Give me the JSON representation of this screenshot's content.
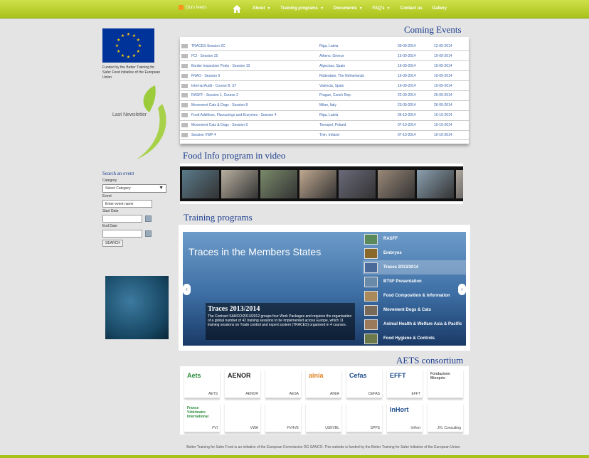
{
  "topbar": {
    "feeds_label": "Ours feeds",
    "nav": [
      {
        "label": "About",
        "caret": true
      },
      {
        "label": "Training programs",
        "caret": true
      },
      {
        "label": "Documents",
        "caret": true
      },
      {
        "label": "FAQ's",
        "caret": true
      },
      {
        "label": "Contact us",
        "caret": false
      },
      {
        "label": "Gallery",
        "caret": false
      }
    ]
  },
  "sidebar": {
    "funded_text": "Funded by the Better Training for Safer Food initiative of the European Union",
    "newsletter_label": "Last Newsletter",
    "search": {
      "heading": "Search an event",
      "category_label": "Category",
      "category_value": "Select Category",
      "event_label": "Event",
      "event_placeholder": "Enter event name",
      "start_label": "Start Date",
      "end_label": "End Date",
      "button": "SEARCH"
    }
  },
  "coming_events": {
    "title": "Coming Events",
    "rows": [
      {
        "name": "TRACES-Session 3C",
        "place": "Riga, Latvia",
        "start": "09-09-2014",
        "end": "12-09-2014"
      },
      {
        "name": "FCI - Session 15",
        "place": "Athens, Greece",
        "start": "15-09-2014",
        "end": "19-09-2014"
      },
      {
        "name": "Border Inspection Posts - Session 10",
        "place": "Algeciras, Spain",
        "start": "16-09-2014",
        "end": "19-09-2014"
      },
      {
        "name": "FNAO - Session 9",
        "place": "Rotterdam, The Netherlands",
        "start": "16-09-2014",
        "end": "19-09-2014"
      },
      {
        "name": "Internal Audit - Course B, S7",
        "place": "Valencia, Spain",
        "start": "16-09-2014",
        "end": "19-09-2014"
      },
      {
        "name": "RASFF - Session 1, Course 2",
        "place": "Prague, Czech Rep.",
        "start": "22-09-2014",
        "end": "26-09-2014"
      },
      {
        "name": "Movement Cats & Dogs - Session 8",
        "place": "Milan, Italy",
        "start": "23-09-2014",
        "end": "26-09-2014"
      },
      {
        "name": "Food Additives, Flavourings and Enzymes - Session 4",
        "place": "Riga, Latvia",
        "start": "06-10-2014",
        "end": "10-10-2014"
      },
      {
        "name": "Movement Cats & Dogs - Session 9",
        "place": "Terespol, Poland",
        "start": "07-10-2014",
        "end": "10-10-2014"
      },
      {
        "name": "Session VWP 4",
        "place": "Trim, Ireland",
        "start": "07-10-2014",
        "end": "10-10-2014"
      }
    ]
  },
  "video": {
    "title": "Food Info program in video"
  },
  "training": {
    "title": "Training programs",
    "slide_title": "Traces in the Members States",
    "caption_heading": "Traces 2013/2014",
    "caption_text": "The Contract SANCO/2013/2012 groups four Work Packages and requires the organisation of a global number of 42 training sessions to be implemented across Europe, which 11 training sessions on Trade control and expert system (TRACES) organised in 4 courses.",
    "programs": [
      "RASFF",
      "Embryos",
      "Traces 2013/2014",
      "BTSF Presentation",
      "Food Composition & Information",
      "Movement Dogs & Cats",
      "Animal Health & Welfare Asia & Pacific",
      "Food Hygiene & Controls"
    ],
    "active_index": 2
  },
  "consortium": {
    "title": "AETS consortium",
    "logos": [
      {
        "mark": "Aets",
        "name": "AETS"
      },
      {
        "mark": "AENOR",
        "name": "AENOR"
      },
      {
        "mark": "",
        "name": "AESA"
      },
      {
        "mark": "ainia",
        "name": "AINIA"
      },
      {
        "mark": "Cefas",
        "name": "CEFAS"
      },
      {
        "mark": "EFFT",
        "name": "EFFT"
      },
      {
        "mark": "Fondazione Minoprio",
        "name": ""
      },
      {
        "mark": "France Vétérinaire International",
        "name": "FVI"
      },
      {
        "mark": "",
        "name": "VWA"
      },
      {
        "mark": "",
        "name": "FVHVE"
      },
      {
        "mark": "",
        "name": "USKVBL"
      },
      {
        "mark": "",
        "name": "SPPS"
      },
      {
        "mark": "InHort",
        "name": "InHort"
      },
      {
        "mark": "",
        "name": "JVL Consulting"
      }
    ]
  },
  "footer": "Better Training for Safer Food is an initiative of the European Commission DG SANCO. This website is funded by the Better Training for Safer Initiative of the European Union.",
  "colors": {
    "topbar": "#a8c21a",
    "heading": "#1b3d8f",
    "link": "#3a64a8"
  }
}
